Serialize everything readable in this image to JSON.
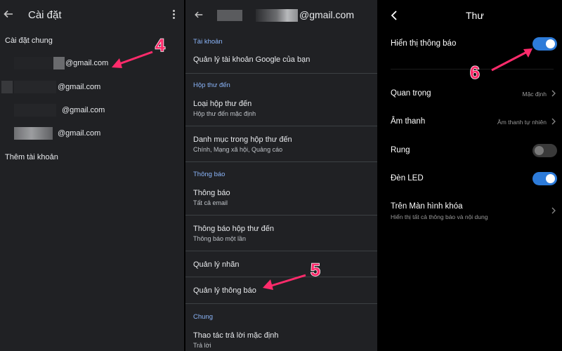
{
  "panel1": {
    "title": "Cài đặt",
    "section": "Cài đặt chung",
    "accounts": [
      {
        "email": "@gmail.com"
      },
      {
        "email": "@gmail.com"
      },
      {
        "email": "@gmail.com"
      },
      {
        "email": "@gmail.com"
      }
    ],
    "add_account": "Thêm tài khoản",
    "annotation": "4"
  },
  "panel2": {
    "header_email": "@gmail.com",
    "sections": {
      "account": "Tài khoản",
      "inbox": "Hộp thư đến",
      "notifications": "Thông báo",
      "general": "Chung"
    },
    "items": {
      "manage_google_account": "Quản lý tài khoản Google của bạn",
      "inbox_type": {
        "label": "Loại hộp thư đến",
        "value": "Hộp thư đến mặc định"
      },
      "inbox_categories": {
        "label": "Danh mục trong hộp thư đến",
        "value": "Chính, Mạng xã hội, Quảng cáo"
      },
      "notifications": {
        "label": "Thông báo",
        "value": "Tất cả email"
      },
      "inbox_notifications": {
        "label": "Thông báo hộp thư đến",
        "value": "Thông báo một lần"
      },
      "manage_labels": "Quản lý nhãn",
      "manage_notifications": "Quản lý thông báo",
      "default_reply": {
        "label": "Thao tác trả lời mặc định",
        "value": "Trả lời"
      }
    },
    "annotation": "5"
  },
  "panel3": {
    "title": "Thư",
    "show_notifications": {
      "label": "Hiển thị thông báo",
      "on": true
    },
    "importance": {
      "label": "Quan trọng",
      "value": "Mặc định"
    },
    "sound": {
      "label": "Âm thanh",
      "value": "Âm thanh tự nhiên"
    },
    "vibrate": {
      "label": "Rung",
      "on": false
    },
    "led": {
      "label": "Đèn LED",
      "on": true
    },
    "lock_screen": {
      "label": "Trên Màn hình khóa",
      "value": "Hiển thị tất cả thông báo và nội dung"
    },
    "annotation": "6"
  },
  "colors": {
    "panel_bg": "#202124",
    "accent_blue": "#8ab4f8",
    "toggle_on": "#2d7bd9",
    "annotation_pink": "#ff2b6b"
  }
}
